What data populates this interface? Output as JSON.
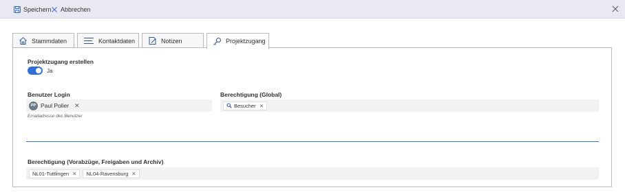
{
  "toolbar": {
    "save_label": "Speichern",
    "cancel_label": "Abbrechen"
  },
  "tabs": [
    {
      "label": "Stammdaten",
      "icon": "home-icon"
    },
    {
      "label": "Kontaktdaten",
      "icon": "list-icon"
    },
    {
      "label": "Notizen",
      "icon": "note-edit-icon"
    },
    {
      "label": "Projektzugang",
      "icon": "key-icon",
      "active": true
    }
  ],
  "form": {
    "project_access_label": "Projektzugang erstellen",
    "toggle_state": "Ja",
    "user_login_label": "Benutzer Login",
    "user": {
      "initials": "PP",
      "name": "Paul Polier"
    },
    "user_hint": "Emailadresse des Benutzer",
    "permission_global_label": "Berechtigung (Global)",
    "permission_global_chip": "Besucher",
    "permission_branches_label": "Berechtigung (Vorabzüge, Freigaben und Archiv)",
    "branch_chips": [
      "NL01-Tuttlingen",
      "NL04-Ravensburg"
    ]
  },
  "colors": {
    "accent": "#2f6fd6",
    "commandbar": "#e9e9f4",
    "field_bg": "#f3f2f1"
  }
}
